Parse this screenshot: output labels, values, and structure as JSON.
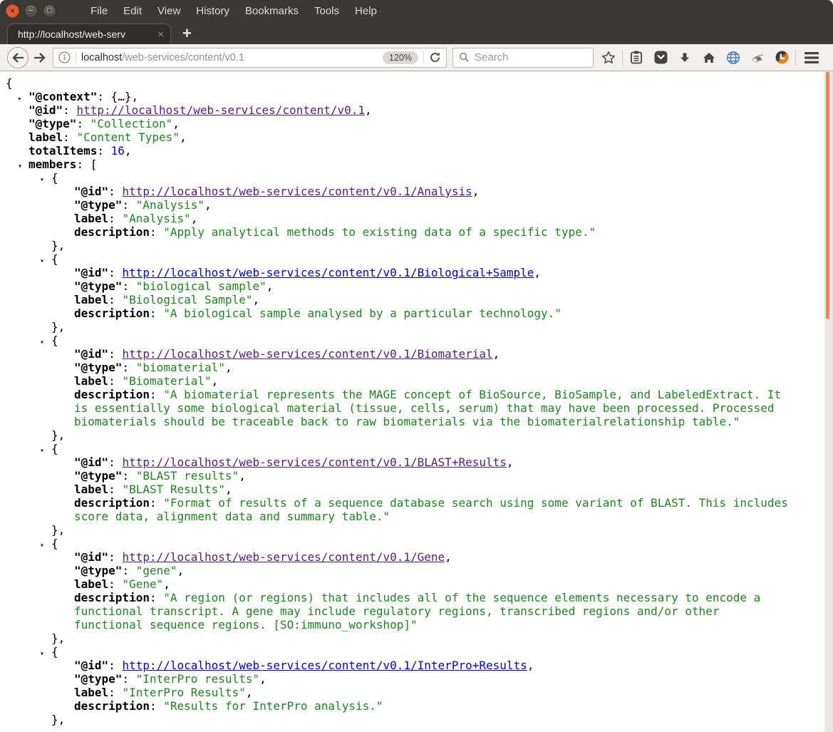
{
  "window": {
    "controls": [
      {
        "name": "close",
        "glyph": "×"
      },
      {
        "name": "minimize",
        "glyph": "−"
      },
      {
        "name": "maximize",
        "glyph": "□"
      }
    ],
    "menu_items": [
      "File",
      "Edit",
      "View",
      "History",
      "Bookmarks",
      "Tools",
      "Help"
    ]
  },
  "tab": {
    "title": "http://localhost/web-serv",
    "close_label": "×",
    "new_tab_label": "+"
  },
  "navbar": {
    "url_host": "localhost",
    "url_path": "/web-services/content/v0.1",
    "zoom_level": "120%",
    "search_placeholder": "Search"
  },
  "colors": {
    "chrome_dark": "#3b3935",
    "toolbar_light": "#f3f1ef",
    "scroll_thumb_orange": "#ef8557",
    "json_string_green": "#188a18",
    "json_number_blue": "#0000ee",
    "link_unvisited": "#0000ee",
    "link_visited": "#551a8b"
  },
  "json_document": {
    "open_brace": "{",
    "collapsed_icon": "▸",
    "expanded_icon": "▾",
    "context_key": "@context",
    "context_value": "{…},",
    "top_props": [
      {
        "key": "@id",
        "quoted": true,
        "kind": "link",
        "value": "http://localhost/web-services/content/v0.1",
        "visited": true
      },
      {
        "key": "@type",
        "quoted": true,
        "kind": "string",
        "value": "Collection"
      },
      {
        "key": "label",
        "quoted": false,
        "kind": "string",
        "value": "Content Types"
      },
      {
        "key": "totalItems",
        "quoted": false,
        "kind": "number",
        "value": "16"
      }
    ],
    "members_key": "members",
    "members_open": "[",
    "member_open": "{",
    "member_close": "},",
    "member_keys": {
      "id": "@id",
      "type": "@type",
      "label": "label",
      "description": "description"
    },
    "members": [
      {
        "id_url": "http://localhost/web-services/content/v0.1/Analysis",
        "visited": true,
        "type": "Analysis",
        "label": "Analysis",
        "description": "Apply analytical methods to existing data of a specific type."
      },
      {
        "id_url": "http://localhost/web-services/content/v0.1/Biological+Sample",
        "visited": false,
        "type": "biological sample",
        "label": "Biological Sample",
        "description": "A biological sample analysed by a particular technology."
      },
      {
        "id_url": "http://localhost/web-services/content/v0.1/Biomaterial",
        "visited": true,
        "type": "biomaterial",
        "label": "Biomaterial",
        "description": "A biomaterial represents the MAGE concept of BioSource, BioSample, and LabeledExtract. It is essentially some biological material (tissue, cells, serum) that may have been processed. Processed biomaterials should be traceable back to raw biomaterials via the biomaterialrelationship table."
      },
      {
        "id_url": "http://localhost/web-services/content/v0.1/BLAST+Results",
        "visited": true,
        "type": "BLAST results",
        "label": "BLAST Results",
        "description": "Format of results of a sequence database search using some variant of BLAST. This includes score data, alignment data and summary table."
      },
      {
        "id_url": "http://localhost/web-services/content/v0.1/Gene",
        "visited": true,
        "type": "gene",
        "label": "Gene",
        "description": "A region (or regions) that includes all of the sequence elements necessary to encode a functional transcript. A gene may include regulatory regions, transcribed regions and/or other functional sequence regions. [SO:immuno_workshop]"
      },
      {
        "id_url": "http://localhost/web-services/content/v0.1/InterPro+Results",
        "visited": false,
        "type": "InterPro results",
        "label": "InterPro Results",
        "description": "Results for InterPro analysis."
      }
    ]
  }
}
